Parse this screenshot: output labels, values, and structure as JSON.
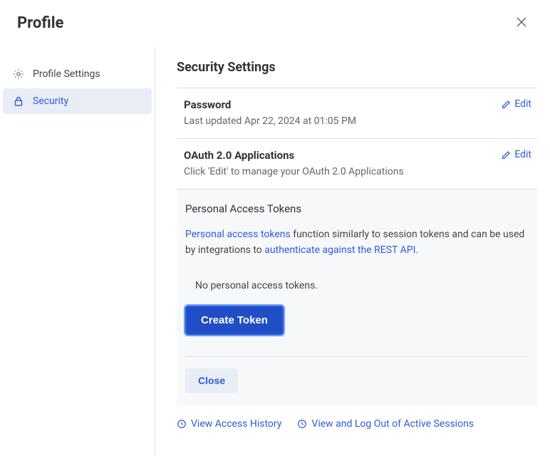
{
  "header": {
    "title": "Profile"
  },
  "sidebar": {
    "items": [
      {
        "label": "Profile Settings"
      },
      {
        "label": "Security"
      }
    ]
  },
  "main": {
    "title": "Security Settings",
    "password": {
      "title": "Password",
      "subtitle": "Last updated Apr 22, 2024 at 01:05 PM",
      "edit": "Edit"
    },
    "oauth": {
      "title": "OAuth 2.0 Applications",
      "subtitle": "Click 'Edit' to manage your OAuth 2.0 Applications",
      "edit": "Edit"
    },
    "pat": {
      "title": "Personal Access Tokens",
      "link1": "Personal access tokens",
      "desc_mid": " function similarly to session tokens and can be used by integrations to ",
      "link2": "authenticate against the REST API",
      "desc_end": ".",
      "empty": "No personal access tokens.",
      "create_button": "Create Token",
      "close_button": "Close"
    },
    "footer": {
      "history": "View Access History",
      "sessions": "View and Log Out of Active Sessions"
    }
  }
}
